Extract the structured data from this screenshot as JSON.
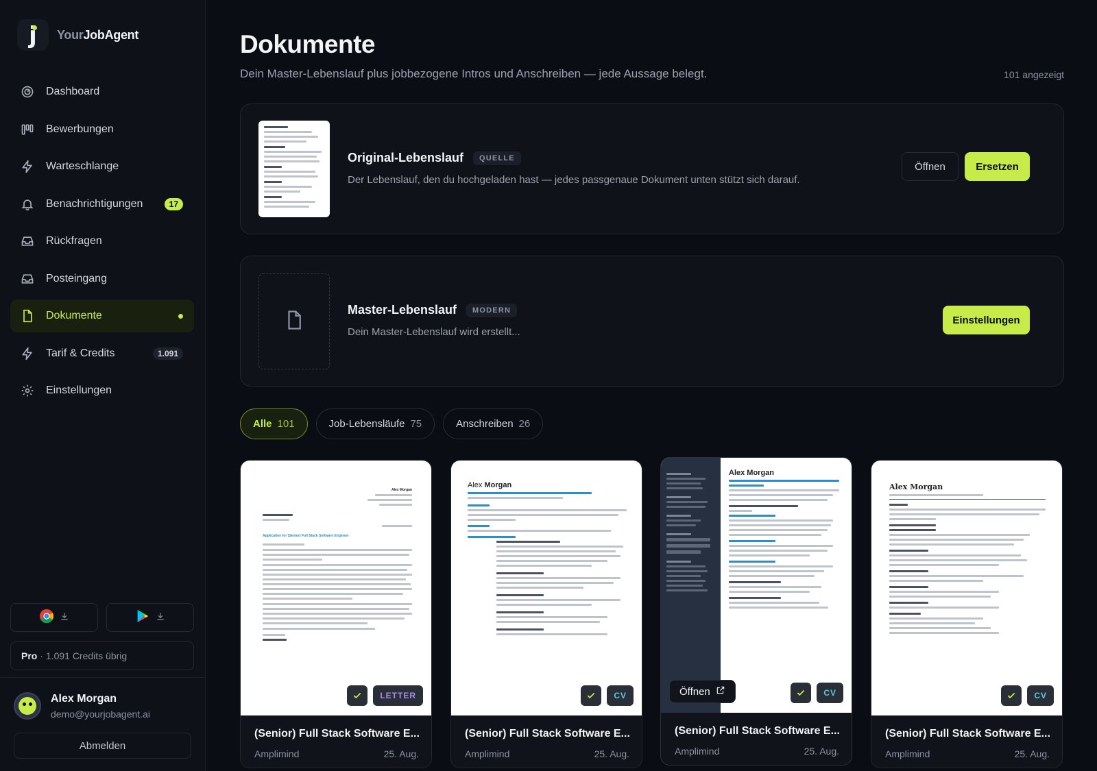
{
  "brand": {
    "prefix": "Your",
    "suffix": "JobAgent",
    "logo_letter": "j"
  },
  "nav": [
    {
      "label": "Dashboard",
      "icon": "gauge-icon"
    },
    {
      "label": "Bewerbungen",
      "icon": "kanban-icon"
    },
    {
      "label": "Warteschlange",
      "icon": "bolt-icon"
    },
    {
      "label": "Benachrichtigungen",
      "icon": "bell-icon",
      "badge": "17"
    },
    {
      "label": "Rückfragen",
      "icon": "inbox-icon"
    },
    {
      "label": "Posteingang",
      "icon": "inbox-icon"
    },
    {
      "label": "Dokumente",
      "icon": "document-icon",
      "active": true
    },
    {
      "label": "Tarif & Credits",
      "icon": "bolt-icon",
      "badge": "1.091"
    },
    {
      "label": "Einstellungen",
      "icon": "gear-icon"
    }
  ],
  "plan": {
    "name": "Pro",
    "credits": "· 1.091 Credits übrig"
  },
  "user": {
    "name": "Alex Morgan",
    "email": "demo@yourjobagent.ai",
    "logout": "Abmelden"
  },
  "page": {
    "title": "Dokumente",
    "subtitle": "Dein Master-Lebenslauf plus jobbezogene Intros und Anschreiben — jede Aussage belegt.",
    "count": "101 angezeigt"
  },
  "original_cv": {
    "title": "Original-Lebenslauf",
    "tag": "QUELLE",
    "desc": "Der Lebenslauf, den du hochgeladen hast — jedes passgenaue Dokument unten stützt sich darauf.",
    "open_label": "Öffnen",
    "replace_label": "Ersetzen"
  },
  "master_cv": {
    "title": "Master-Lebenslauf",
    "tag": "MODERN",
    "desc": "Dein Master-Lebenslauf wird erstellt...",
    "settings_label": "Einstellungen"
  },
  "filters": [
    {
      "label": "Alle",
      "count": "101",
      "active": true
    },
    {
      "label": "Job-Lebensläufe",
      "count": "75"
    },
    {
      "label": "Anschreiben",
      "count": "26"
    }
  ],
  "preview": {
    "name_first": "Alex",
    "name_last": "Morgan",
    "full_name": "Alex Morgan",
    "letter_heading": "Application for (Senior) Full Stack Software Engineer"
  },
  "documents": [
    {
      "title": "(Senior) Full Stack Software E...",
      "company": "Amplimind",
      "date": "25. Aug.",
      "type": "LETTER"
    },
    {
      "title": "(Senior) Full Stack Software E...",
      "company": "Amplimind",
      "date": "25. Aug.",
      "type": "CV"
    },
    {
      "title": "(Senior) Full Stack Software E...",
      "company": "Amplimind",
      "date": "25. Aug.",
      "type": "CV",
      "open_label": "Öffnen"
    },
    {
      "title": "(Senior) Full Stack Software E...",
      "company": "Amplimind",
      "date": "25. Aug.",
      "type": "CV"
    }
  ],
  "colors": {
    "accent": "#c7ec4a",
    "background": "#0b0d14",
    "letter": "#a98df0",
    "cv": "#5fc7e0"
  }
}
